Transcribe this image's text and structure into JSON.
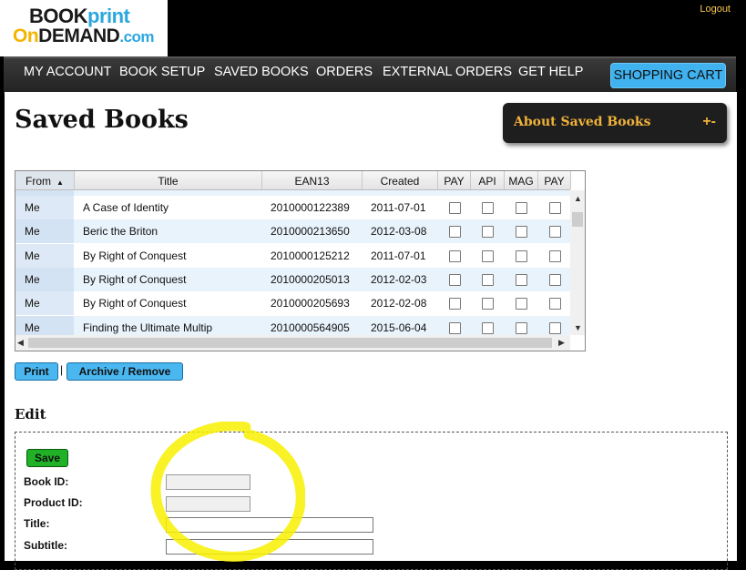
{
  "logo": {
    "book": "BOOK",
    "print": "print",
    "on": "On",
    "demand": "DEMAND",
    "com": ".com"
  },
  "header": {
    "logout": "Logout"
  },
  "nav": {
    "items": [
      "MY ACCOUNT",
      "BOOK SETUP",
      "SAVED BOOKS",
      "ORDERS",
      "EXTERNAL ORDERS",
      "GET HELP"
    ],
    "cart": "SHOPPING CART"
  },
  "page": {
    "title": "Saved Books"
  },
  "about": {
    "label": "About Saved Books",
    "toggle": "+-"
  },
  "grid": {
    "columns": [
      "From",
      "Title",
      "EAN13",
      "Created",
      "PAY",
      "API",
      "MAG",
      "PAY"
    ],
    "rows": [
      {
        "from": "Me",
        "title": "A Case of Identity",
        "ean": "2010000122389",
        "created": "2011-07-01"
      },
      {
        "from": "Me",
        "title": "Beric the Briton",
        "ean": "2010000213650",
        "created": "2012-03-08"
      },
      {
        "from": "Me",
        "title": "By Right of Conquest",
        "ean": "2010000125212",
        "created": "2011-07-01"
      },
      {
        "from": "Me",
        "title": "By Right of Conquest",
        "ean": "2010000205013",
        "created": "2012-02-03"
      },
      {
        "from": "Me",
        "title": "By Right of Conquest",
        "ean": "2010000205693",
        "created": "2012-02-08"
      },
      {
        "from": "Me",
        "title": "Finding the Ultimate Multip",
        "ean": "2010000564905",
        "created": "2015-06-04"
      }
    ]
  },
  "actions": {
    "print": "Print",
    "separator": "|",
    "archive": "Archive / Remove"
  },
  "edit": {
    "heading": "Edit",
    "save": "Save",
    "fields": {
      "book_id": "Book ID:",
      "product_id": "Product ID:",
      "title": "Title:",
      "subtitle": "Subtitle:"
    }
  },
  "colors": {
    "accent": "#3fb2ef",
    "save": "#21b127",
    "about_text": "#f0b23a",
    "highlight": "#f8f000"
  }
}
